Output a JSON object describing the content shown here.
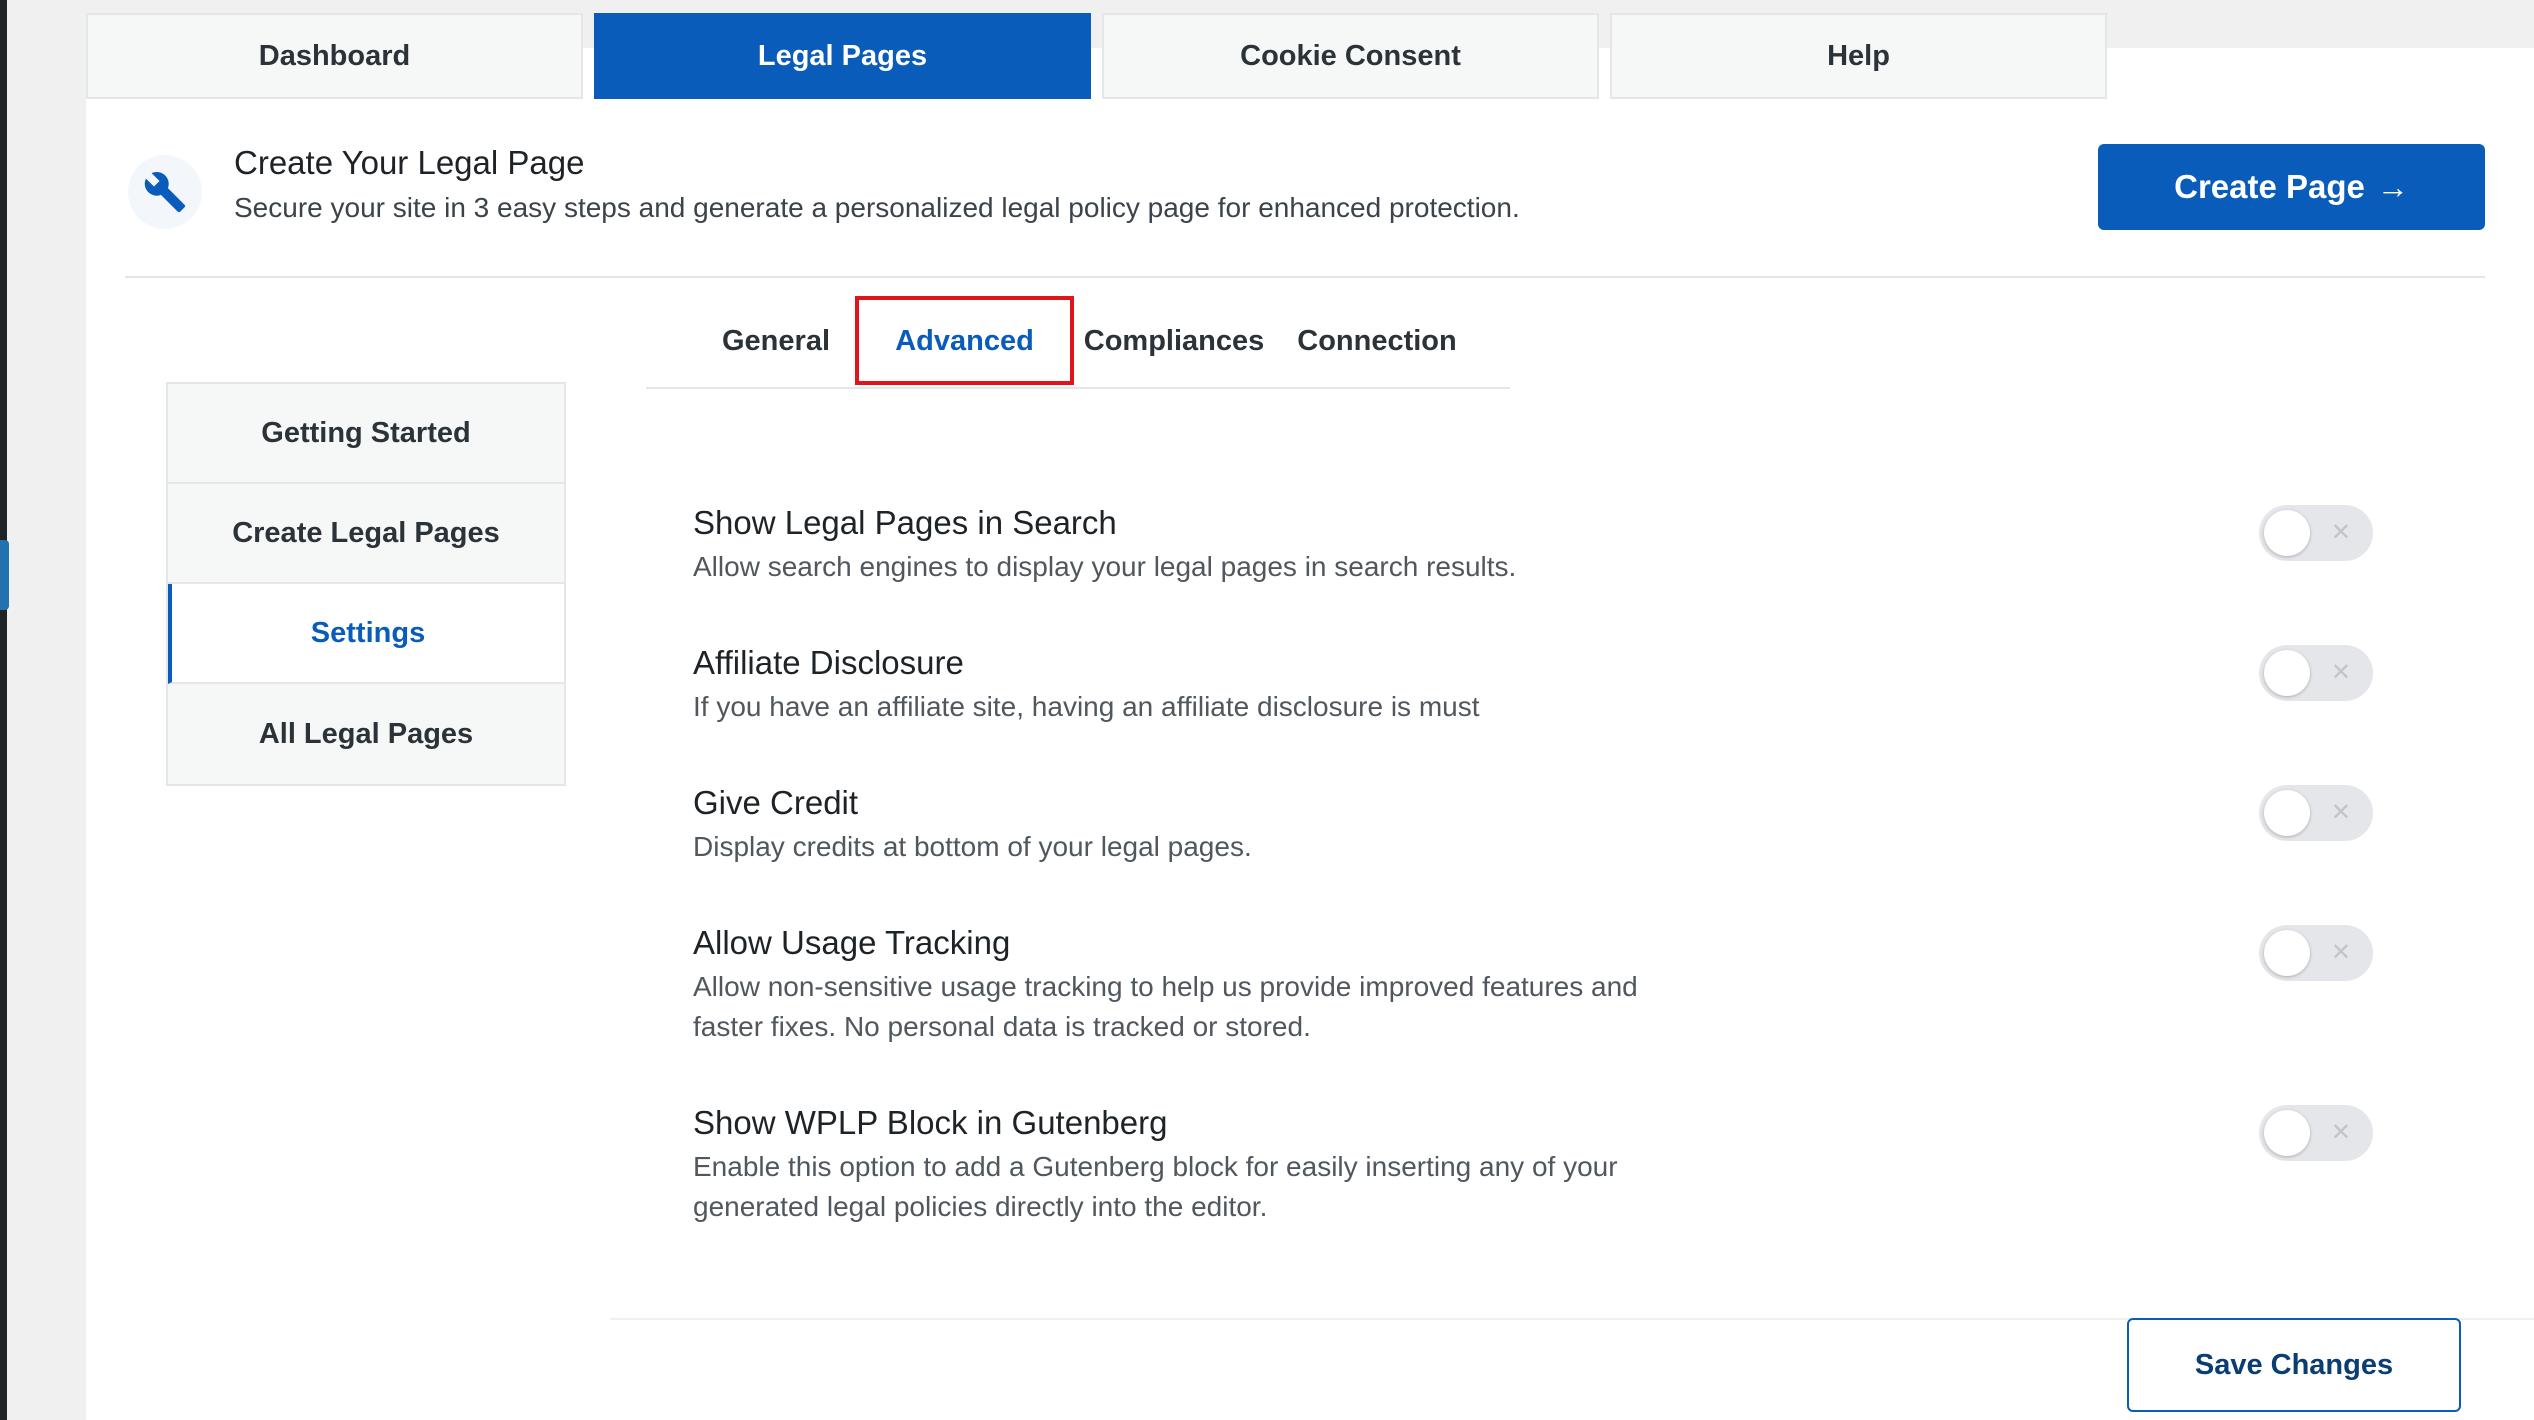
{
  "top_tabs": [
    {
      "label": "Dashboard",
      "active": false
    },
    {
      "label": "Legal Pages",
      "active": true
    },
    {
      "label": "Cookie Consent",
      "active": false
    },
    {
      "label": "Help",
      "active": false
    }
  ],
  "header": {
    "icon": "wrench-icon",
    "title": "Create Your Legal Page",
    "subtitle": "Secure your site in 3 easy steps and generate a personalized legal policy page for enhanced protection.",
    "create_button": "Create Page",
    "create_button_icon": "arrow-right-icon"
  },
  "sub_tabs": [
    {
      "label": "General",
      "active": false
    },
    {
      "label": "Advanced",
      "active": true
    },
    {
      "label": "Compliances",
      "active": false
    },
    {
      "label": "Connection",
      "active": false
    }
  ],
  "sidebar": {
    "items": [
      {
        "label": "Getting Started",
        "active": false
      },
      {
        "label": "Create Legal Pages",
        "active": false
      },
      {
        "label": "Settings",
        "active": true
      },
      {
        "label": "All Legal Pages",
        "active": false
      }
    ]
  },
  "settings": [
    {
      "title": "Show Legal Pages in Search",
      "description": "Allow search engines to display your legal pages in search results.",
      "enabled": false
    },
    {
      "title": "Affiliate Disclosure",
      "description": "If you have an affiliate site, having an affiliate disclosure is must",
      "enabled": false
    },
    {
      "title": "Give Credit",
      "description": "Display credits at bottom of your legal pages.",
      "enabled": false
    },
    {
      "title": "Allow Usage Tracking",
      "description": "Allow non-sensitive usage tracking to help us provide improved features and faster fixes. No personal data is tracked or stored.",
      "enabled": false
    },
    {
      "title": "Show WPLP Block in Gutenberg",
      "description": "Enable this option to add a Gutenberg block for easily inserting any of your generated legal policies directly into the editor.",
      "enabled": false
    }
  ],
  "toggle_off_symbol": "✕",
  "footer": {
    "save_button": "Save Changes"
  },
  "colors": {
    "accent": "#0a5cba",
    "highlight": "#e0151c"
  }
}
